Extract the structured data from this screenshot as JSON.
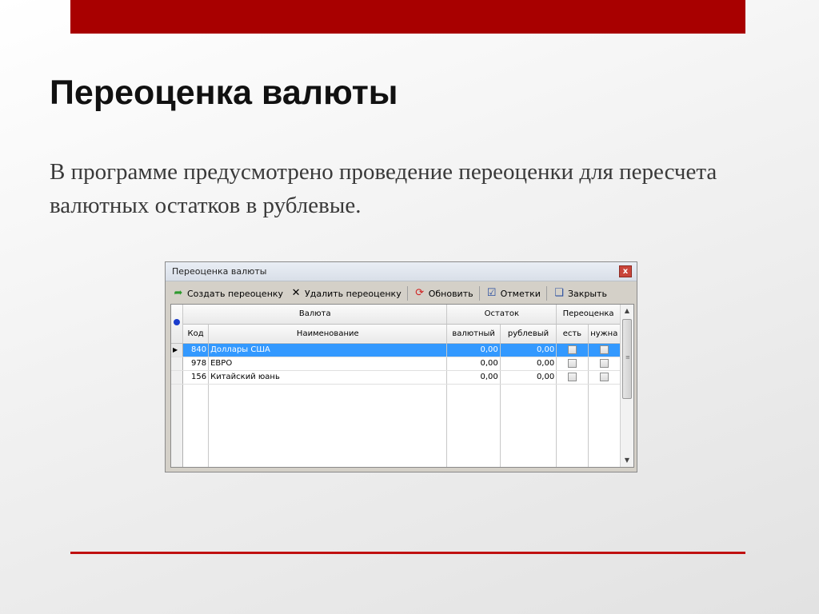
{
  "slide": {
    "title": "Переоценка валюты",
    "body": "В программе предусмотрено проведение переоценки для пересчета валютных остатков в рублевые."
  },
  "window": {
    "title": "Переоценка валюты",
    "close_label": "x",
    "toolbar": {
      "create_label": "Создать переоценку",
      "delete_label": "Удалить переоценку",
      "refresh_label": "Обновить",
      "marks_label": "Отметки",
      "close_label": "Закрыть"
    },
    "grid": {
      "group_headers": {
        "currency": "Валюта",
        "balance": "Остаток",
        "revaluation": "Переоценка"
      },
      "columns": {
        "code": "Код",
        "name": "Наименование",
        "currency_amount": "валютный",
        "ruble_amount": "рублевый",
        "exists": "есть",
        "needed": "нужна"
      },
      "rows": [
        {
          "code": "840",
          "name": "Доллары США",
          "currency_amount": "0,00",
          "ruble_amount": "0,00"
        },
        {
          "code": "978",
          "name": "ЕВРО",
          "currency_amount": "0,00",
          "ruble_amount": "0,00"
        },
        {
          "code": "156",
          "name": "Китайский юань",
          "currency_amount": "0,00",
          "ruble_amount": "0,00"
        }
      ]
    }
  },
  "icons": {
    "create": "arrow-forward-icon",
    "delete": "x-icon",
    "refresh": "refresh-icon",
    "marks": "marks-icon",
    "close": "close-window-icon"
  },
  "colors": {
    "accent": "#a80000",
    "selection": "#3399ff"
  }
}
